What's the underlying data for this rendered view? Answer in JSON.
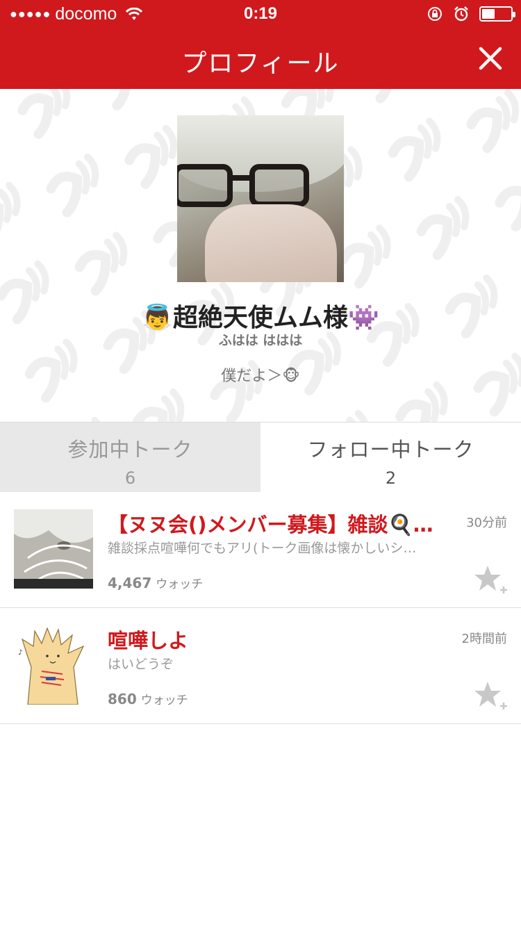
{
  "status_bar": {
    "signal_dots": "●●●●●",
    "carrier": "docomo",
    "time": "0:19",
    "battery_level": 0.45,
    "icons": [
      "wifi-icon",
      "rotation-lock-icon",
      "alarm-icon",
      "battery-icon"
    ]
  },
  "nav": {
    "title": "プロフィール",
    "close_icon": "close-icon"
  },
  "profile": {
    "name": "👼超絶天使ムム様👾",
    "subname": "ふはは ははは",
    "status_message": "僕だよ＞🐵"
  },
  "tabs": [
    {
      "label": "参加中トーク",
      "count": "6",
      "active": false
    },
    {
      "label": "フォロー中トーク",
      "count": "2",
      "active": true
    }
  ],
  "talks": [
    {
      "title": "【ヌヌ会()メンバー募集】雑談🍳…",
      "time": "30分前",
      "description": "雑談採点喧嘩何でもアリ(トーク画像は懐かしいシ…",
      "watch_count": "4,467",
      "watch_label": "ウォッチ"
    },
    {
      "title": "喧嘩しよ",
      "time": "2時間前",
      "description": "はいどうぞ",
      "watch_count": "860",
      "watch_label": "ウォッチ"
    }
  ],
  "colors": {
    "brand_red": "#d0191d",
    "tab_inactive_bg": "#e8e8e8",
    "star_gray": "#c8c8c8"
  }
}
